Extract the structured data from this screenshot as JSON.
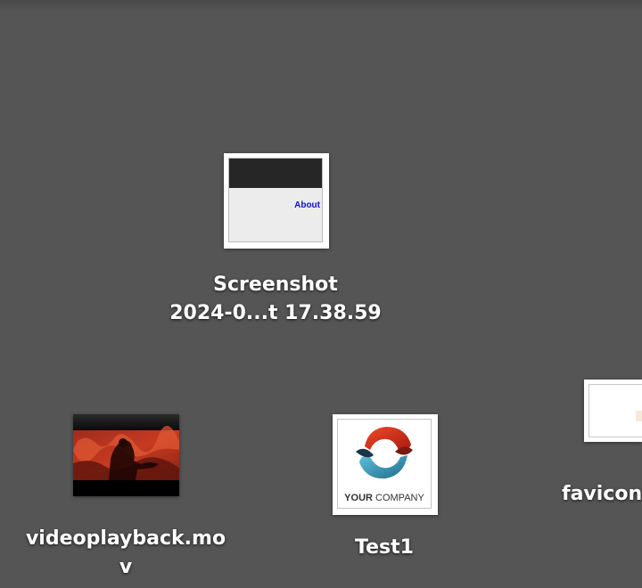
{
  "desktop": {
    "background_color": "#555555",
    "items": [
      {
        "name": "screenshot-file",
        "label_line1": "Screenshot",
        "label_line2": "2024-0...t 17.38.59",
        "thumbnail_text": "About",
        "icon": "image-thumbnail-icon"
      },
      {
        "name": "favicon-file",
        "label_line1": "favicon",
        "icon": "image-thumbnail-icon"
      },
      {
        "name": "video-file",
        "label_line1": "videoplayback.mo",
        "label_line2": "v",
        "icon": "video-thumbnail-icon"
      },
      {
        "name": "test1-file",
        "label_line1": "Test1",
        "thumbnail_text_bold": "YOUR",
        "thumbnail_text_rest": " COMPANY",
        "icon": "logo-thumbnail-icon"
      }
    ]
  }
}
